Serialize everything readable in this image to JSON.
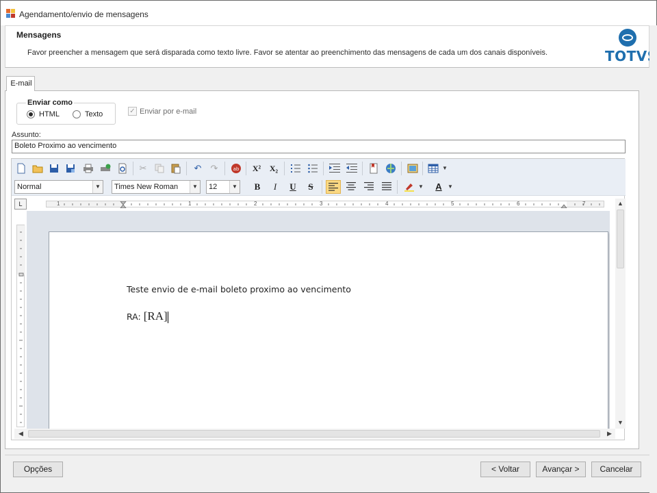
{
  "window": {
    "title": "Agendamento/envio de mensagens"
  },
  "header": {
    "title": "Mensagens",
    "description": "Favor preencher a mensagem que será disparada como texto livre. Favor se atentar ao preenchimento das mensagens de cada um dos canais disponíveis.",
    "logo_text": "TOTVS"
  },
  "tabs": [
    {
      "label": "E-mail",
      "active": true
    }
  ],
  "send_as": {
    "title": "Enviar como",
    "options": [
      {
        "label": "HTML",
        "selected": true
      },
      {
        "label": "Texto",
        "selected": false
      }
    ]
  },
  "send_email": {
    "label": "Enviar por e-mail",
    "checked": true,
    "enabled": false
  },
  "subject": {
    "label": "Assunto:",
    "value": "Boleto Proximo ao vencimento"
  },
  "toolbar": {
    "style": "Normal",
    "font": "Times New Roman",
    "size": "12",
    "bold": "B",
    "italic": "I",
    "underline": "U",
    "strike": "S",
    "superscript_glyph": "X²",
    "subscript_glyph": "X₂",
    "font_color_glyph": "A"
  },
  "ruler_numbers": [
    "1",
    "1",
    "2",
    "3",
    "4",
    "5",
    "6",
    "7"
  ],
  "document": {
    "line1": "Teste envio de e-mail boleto proximo ao vencimento",
    "line2_prefix": "RA: ",
    "line2_field": "[RA]"
  },
  "buttons": {
    "options": "Opções",
    "back": "< Voltar",
    "next": "Avançar >",
    "cancel": "Cancelar"
  },
  "colors": {
    "brand": "#1f6fae",
    "active_tool": "#fbd983"
  }
}
